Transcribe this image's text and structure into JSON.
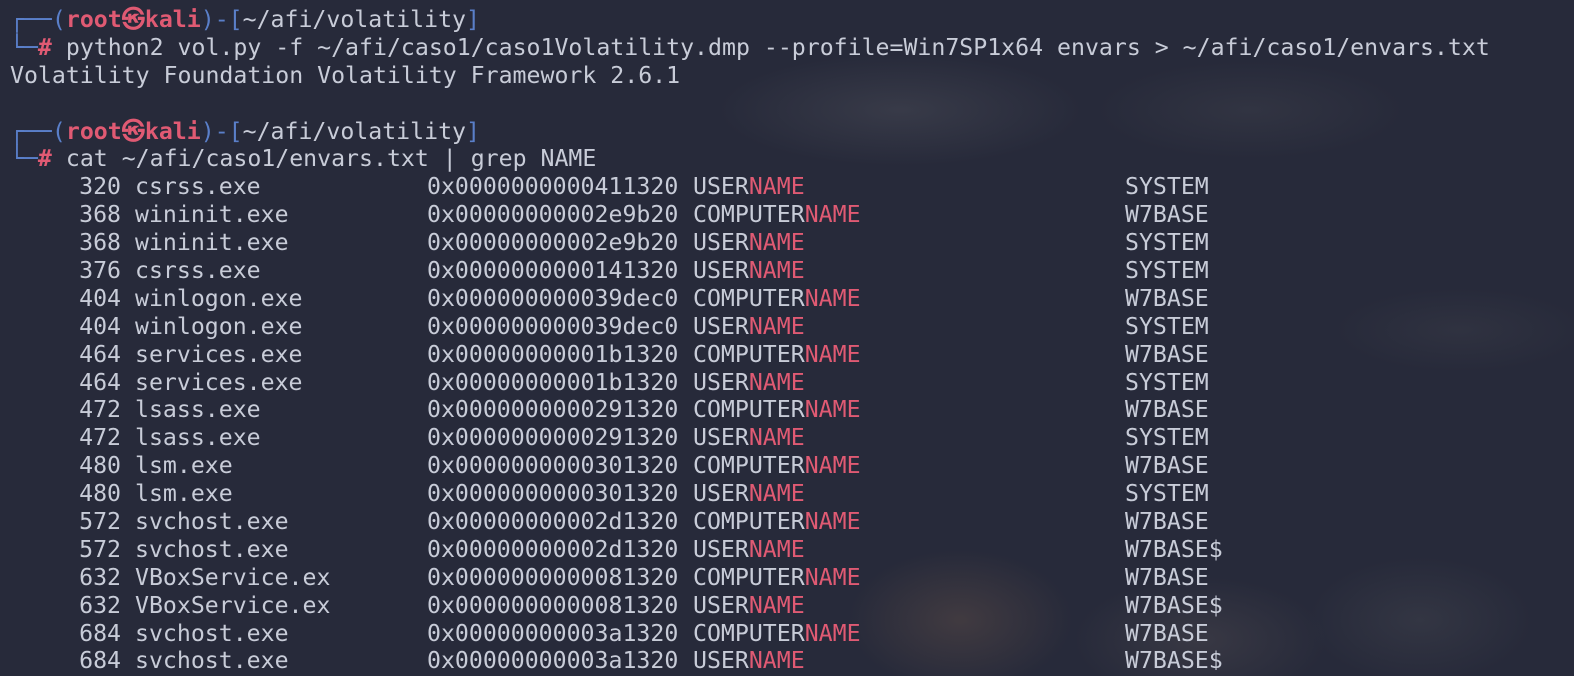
{
  "prompt": {
    "user": "root",
    "skull": "㉿",
    "host": "kali",
    "path": "~/afi/volatility",
    "hash": "#"
  },
  "commands": [
    "python2 vol.py -f ~/afi/caso1/caso1Volatility.dmp --profile=Win7SP1x64 envars > ~/afi/caso1/envars.txt",
    "cat ~/afi/caso1/envars.txt | grep NAME"
  ],
  "output_line": "Volatility Foundation Volatility Framework 2.6.1",
  "grep_match": "NAME",
  "rows": [
    {
      "pid": "320",
      "process": "csrss.exe",
      "address": "0x0000000000411320",
      "var_prefix": "USER",
      "value": "SYSTEM"
    },
    {
      "pid": "368",
      "process": "wininit.exe",
      "address": "0x00000000002e9b20",
      "var_prefix": "COMPUTER",
      "value": "W7BASE"
    },
    {
      "pid": "368",
      "process": "wininit.exe",
      "address": "0x00000000002e9b20",
      "var_prefix": "USER",
      "value": "SYSTEM"
    },
    {
      "pid": "376",
      "process": "csrss.exe",
      "address": "0x0000000000141320",
      "var_prefix": "USER",
      "value": "SYSTEM"
    },
    {
      "pid": "404",
      "process": "winlogon.exe",
      "address": "0x000000000039dec0",
      "var_prefix": "COMPUTER",
      "value": "W7BASE"
    },
    {
      "pid": "404",
      "process": "winlogon.exe",
      "address": "0x000000000039dec0",
      "var_prefix": "USER",
      "value": "SYSTEM"
    },
    {
      "pid": "464",
      "process": "services.exe",
      "address": "0x00000000001b1320",
      "var_prefix": "COMPUTER",
      "value": "W7BASE"
    },
    {
      "pid": "464",
      "process": "services.exe",
      "address": "0x00000000001b1320",
      "var_prefix": "USER",
      "value": "SYSTEM"
    },
    {
      "pid": "472",
      "process": "lsass.exe",
      "address": "0x0000000000291320",
      "var_prefix": "COMPUTER",
      "value": "W7BASE"
    },
    {
      "pid": "472",
      "process": "lsass.exe",
      "address": "0x0000000000291320",
      "var_prefix": "USER",
      "value": "SYSTEM"
    },
    {
      "pid": "480",
      "process": "lsm.exe",
      "address": "0x0000000000301320",
      "var_prefix": "COMPUTER",
      "value": "W7BASE"
    },
    {
      "pid": "480",
      "process": "lsm.exe",
      "address": "0x0000000000301320",
      "var_prefix": "USER",
      "value": "SYSTEM"
    },
    {
      "pid": "572",
      "process": "svchost.exe",
      "address": "0x00000000002d1320",
      "var_prefix": "COMPUTER",
      "value": "W7BASE"
    },
    {
      "pid": "572",
      "process": "svchost.exe",
      "address": "0x00000000002d1320",
      "var_prefix": "USER",
      "value": "W7BASE$"
    },
    {
      "pid": "632",
      "process": "VBoxService.ex",
      "address": "0x0000000000081320",
      "var_prefix": "COMPUTER",
      "value": "W7BASE"
    },
    {
      "pid": "632",
      "process": "VBoxService.ex",
      "address": "0x0000000000081320",
      "var_prefix": "USER",
      "value": "W7BASE$"
    },
    {
      "pid": "684",
      "process": "svchost.exe",
      "address": "0x00000000003a1320",
      "var_prefix": "COMPUTER",
      "value": "W7BASE"
    },
    {
      "pid": "684",
      "process": "svchost.exe",
      "address": "0x00000000003a1320",
      "var_prefix": "USER",
      "value": "W7BASE$"
    }
  ],
  "colors": {
    "background": "#272a3a",
    "prompt_frame": "#5a7fc9",
    "prompt_user": "#e05a73",
    "match_highlight": "#e05a73",
    "text": "#c8ccd8"
  }
}
